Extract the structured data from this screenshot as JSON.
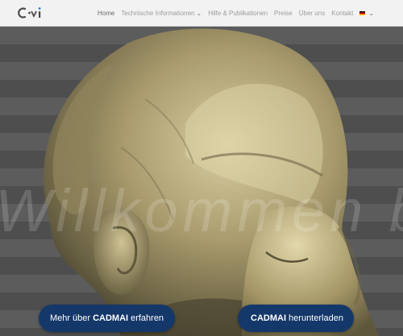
{
  "brand": {
    "logo_text": "c⋅i"
  },
  "nav": {
    "items": [
      {
        "label": "Home",
        "active": true
      },
      {
        "label": "Technische Informationen",
        "has_dropdown": true
      },
      {
        "label": "Hilfe & Publikationen"
      },
      {
        "label": "Preise"
      },
      {
        "label": "Über uns"
      },
      {
        "label": "Kontakt"
      }
    ],
    "language": "DE"
  },
  "hero": {
    "watermark": "Willkommen bei CADMAI",
    "buttons": [
      {
        "prefix": "Mehr über",
        "brand": "CADMAI",
        "suffix": "erfahren"
      },
      {
        "prefix": "",
        "brand": "CADMAI",
        "suffix": "herunterladen"
      }
    ]
  },
  "colors": {
    "accent_button": "#14386a",
    "nav_bg": "#f2f2f2"
  }
}
